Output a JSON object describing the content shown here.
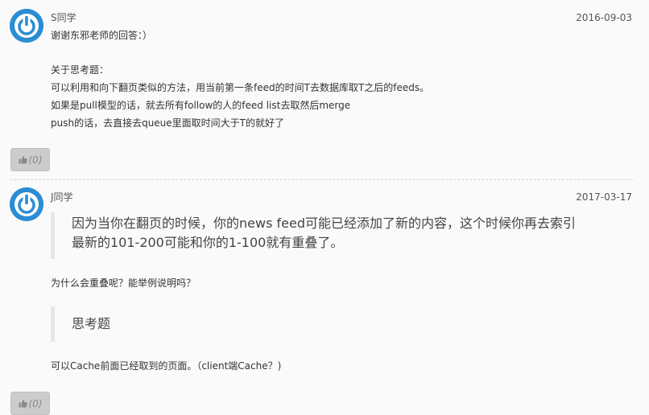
{
  "comments": [
    {
      "author": "S同学",
      "date": "2016-09-03",
      "lines": [
        "谢谢东邪老师的回答：）",
        "",
        "关于思考题：",
        "可以利用和向下翻页类似的方法，用当前第一条feed的时间T去数据库取T之后的feeds。",
        "如果是pull模型的话，就去所有follow的人的feed list去取然后merge",
        "push的话，去直接去queue里面取时间大于T的就好了"
      ],
      "like_label": "(0)"
    },
    {
      "author": "J同学",
      "date": "2017-03-17",
      "quote1": [
        "因为当你在翻页的时候，你的news feed可能已经添加了新的内容，这个时候你再去索引",
        "最新的101-200可能和你的1-100就有重叠了。"
      ],
      "text1": "为什么会重叠呢？能举例说明吗？",
      "quote2": "思考题",
      "text2": "可以Cache前面已经取到的页面。（client端Cache？)",
      "like_label": "(0)"
    }
  ],
  "colors": {
    "avatar": "#2b8dd3",
    "background": "#fafafa",
    "button": "#cccccc"
  },
  "icons": {
    "avatar": "power-symbol-icon",
    "like": "thumbs-up-icon"
  }
}
